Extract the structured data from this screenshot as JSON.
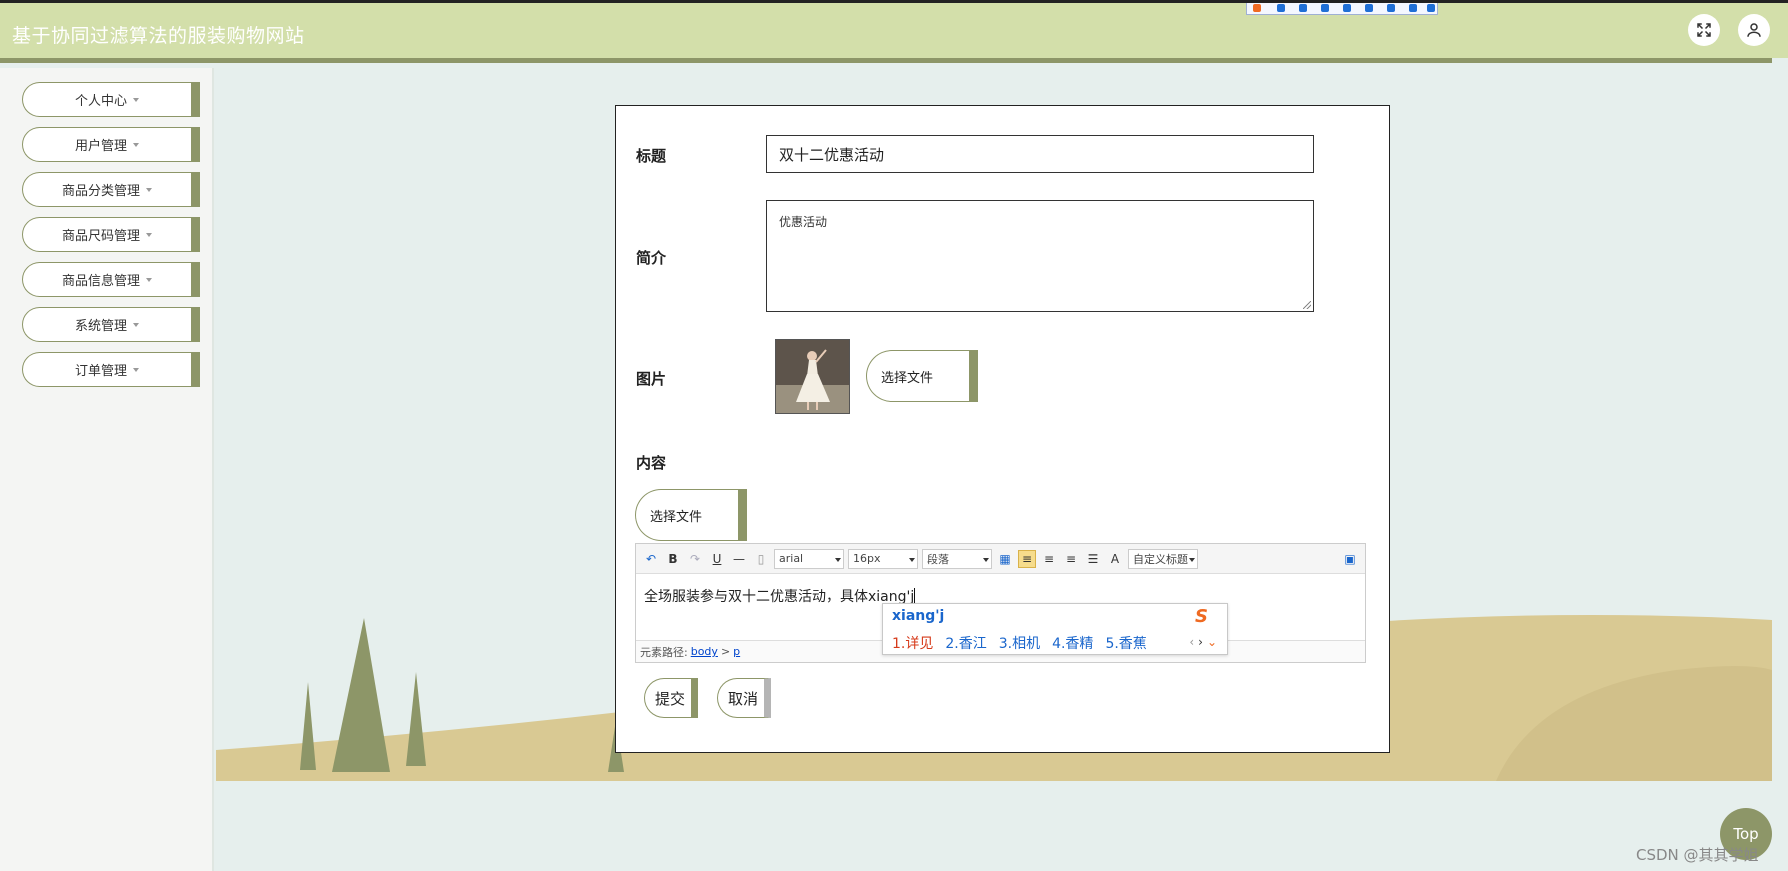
{
  "header": {
    "site_title": "基于协同过滤算法的服装购物网站"
  },
  "sidebar": {
    "items": [
      {
        "label": "个人中心"
      },
      {
        "label": "用户管理"
      },
      {
        "label": "商品分类管理"
      },
      {
        "label": "商品尺码管理"
      },
      {
        "label": "商品信息管理"
      },
      {
        "label": "系统管理"
      },
      {
        "label": "订单管理"
      }
    ]
  },
  "form": {
    "title_label": "标题",
    "title_value": "双十二优惠活动",
    "intro_label": "简介",
    "intro_value": "优惠活动",
    "image_label": "图片",
    "image_file_button": "选择文件",
    "content_label": "内容",
    "content_file_button": "选择文件",
    "submit_label": "提交",
    "cancel_label": "取消"
  },
  "editor": {
    "font_family": "arial",
    "font_size": "16px",
    "paragraph": "段落",
    "custom_title": "自定义标题",
    "bold_glyph": "B",
    "underline_glyph": "U",
    "color_glyph": "A",
    "body_text": "全场服装参与双十二优惠活动，具体xiang'j",
    "path_label": "元素路径:",
    "path_body": "body",
    "path_sep": ">",
    "path_p": "p"
  },
  "ime": {
    "input": "xiang'j",
    "candidates": [
      "1.详见",
      "2.香江",
      "3.相机",
      "4.香精",
      "5.香蕉"
    ],
    "logo": "S"
  },
  "top_button": "Top",
  "watermark": "CSDN @其其学姐",
  "colors": {
    "header_bg": "#d3dfaa",
    "accent": "#8d9668",
    "page_bg": "#e6efed",
    "sand": "#d9c993"
  }
}
